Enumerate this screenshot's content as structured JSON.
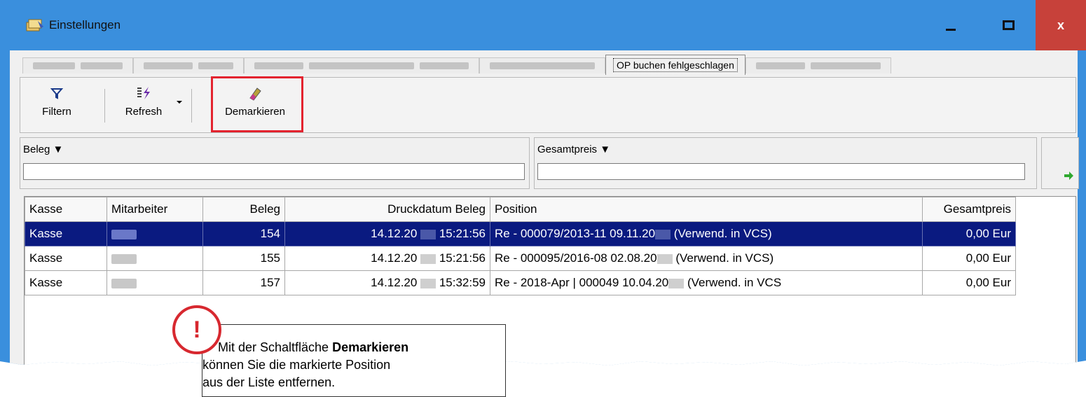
{
  "window": {
    "title": "Einstellungen",
    "close_label": "x"
  },
  "tabs": {
    "active_label": "OP buchen fehlgeschlagen"
  },
  "toolbar": {
    "filter_label": "Filtern",
    "refresh_label": "Refresh",
    "demark_label": "Demarkieren"
  },
  "filters": {
    "beleg_label": "Beleg ▼",
    "beleg_value": "",
    "gesamtpreis_label": "Gesamtpreis ▼",
    "gesamtpreis_value": ""
  },
  "grid": {
    "columns": [
      "Kasse",
      "Mitarbeiter",
      "Beleg",
      "Druckdatum Beleg",
      "Position",
      "Gesamtpreis"
    ],
    "rows": [
      {
        "kasse": "Kasse",
        "beleg": "154",
        "datum_a": "14.12.20",
        "datum_b": "15:21:56",
        "pos_a": "Re - 000079/2013-11 09.11.20",
        "pos_b": "(Verwend. in VCS)",
        "preis": "0,00 Eur"
      },
      {
        "kasse": "Kasse",
        "beleg": "155",
        "datum_a": "14.12.20",
        "datum_b": "15:21:56",
        "pos_a": "Re - 000095/2016-08 02.08.20",
        "pos_b": "(Verwend. in VCS)",
        "preis": "0,00 Eur"
      },
      {
        "kasse": "Kasse",
        "beleg": "157",
        "datum_a": "14.12.20",
        "datum_b": "15:32:59",
        "pos_a": "Re - 2018-Apr | 000049 10.04.20",
        "pos_b": "(Verwend. in VCS",
        "preis": "0,00 Eur"
      }
    ]
  },
  "callout": {
    "icon_text": "!",
    "text_pre": "Mit der Schaltfläche ",
    "text_bold": "Demarkieren",
    "line2": "können Sie die markierte Position",
    "line3": "aus der Liste entfernen."
  },
  "colors": {
    "titlebar": "#3a8fdd",
    "close_button": "#c7413a",
    "selection": "#0a1a80",
    "highlight": "#e3232f"
  },
  "icons": [
    "app-icon",
    "minimize-icon",
    "maximize-icon",
    "close-icon",
    "filter-icon",
    "refresh-icon",
    "dropdown-arrow-icon",
    "eraser-icon",
    "arrow-right-icon",
    "warning-icon"
  ]
}
